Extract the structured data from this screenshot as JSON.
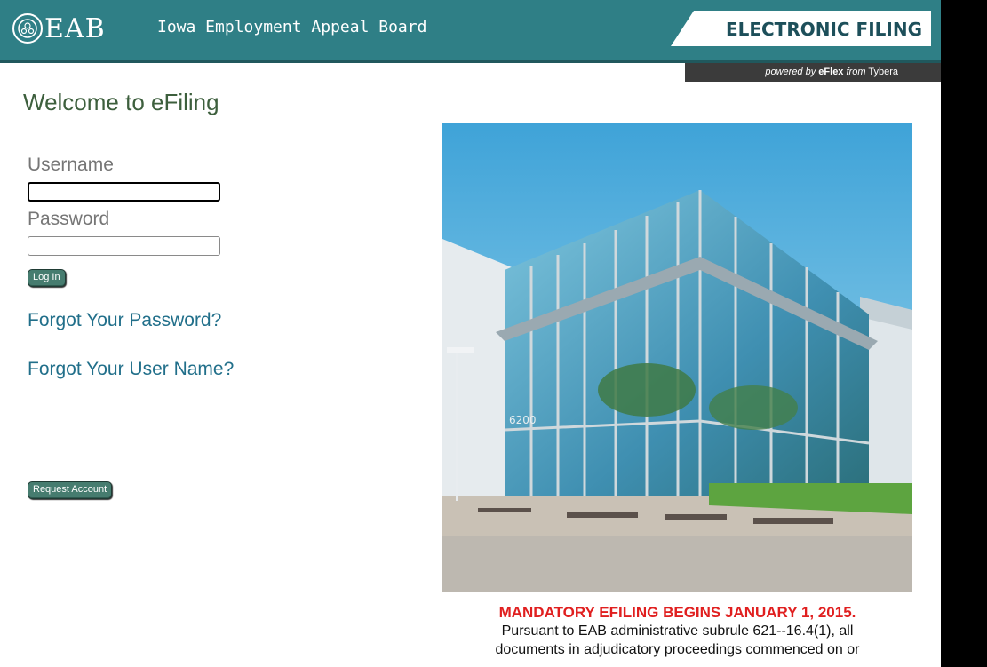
{
  "header": {
    "logo_text": "EAB",
    "org_name": "Iowa Employment Appeal Board",
    "banner_title": "ELECTRONIC FILING",
    "powered_prefix": "powered by",
    "powered_product": "eFlex",
    "powered_from": "from",
    "powered_vendor": "Tybera"
  },
  "page": {
    "title": "Welcome to eFiling"
  },
  "login": {
    "username_label": "Username",
    "username_value": "",
    "password_label": "Password",
    "password_value": "",
    "login_button": "Log In",
    "forgot_password": "Forgot Your Password?",
    "forgot_username": "Forgot Your User Name?",
    "request_account": "Request Account"
  },
  "notice": {
    "headline": "MANDATORY EFILING BEGINS JANUARY 1, 2015.",
    "line1": "Pursuant to EAB administrative subrule 621--16.4(1), all",
    "line2": "documents in adjudicatory proceedings commenced on or"
  },
  "colors": {
    "header_bg": "#2f7f86",
    "button_bg": "#467c6f",
    "link": "#216f8a",
    "title": "#3d5f3d",
    "notice_headline": "#e01f1f"
  },
  "image": {
    "building_number": "6200"
  }
}
